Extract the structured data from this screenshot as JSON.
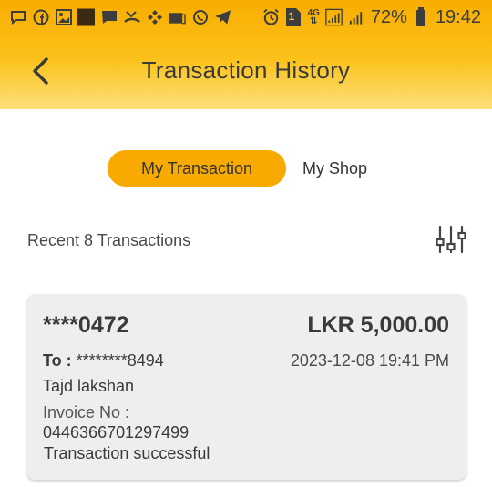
{
  "status_bar": {
    "battery_percent": "72%",
    "time": "19:42",
    "network": "4G",
    "notification_badge": "1",
    "icons": [
      "chat-bubble-icon",
      "facebook-icon",
      "gallery-icon",
      "square-icon",
      "message-icon",
      "missed-call-icon",
      "binance-icon",
      "news-icon",
      "whatsapp-icon",
      "telegram-icon",
      "alarm-icon",
      "sim-icon",
      "signal-icon",
      "battery-icon"
    ]
  },
  "header": {
    "title": "Transaction History",
    "accent_color": "#f8aa00"
  },
  "tabs": {
    "active": "My Transaction",
    "inactive": "My Shop"
  },
  "list": {
    "summary": "Recent 8 Transactions"
  },
  "transaction": {
    "account": "****0472",
    "amount": "LKR 5,000.00",
    "to_label": "To :",
    "to_value": "********8494",
    "datetime": "2023-12-08 19:41 PM",
    "name": "Tajd lakshan",
    "invoice_label": "Invoice No :",
    "invoice_number": "0446366701297499",
    "status": "Transaction successful"
  }
}
